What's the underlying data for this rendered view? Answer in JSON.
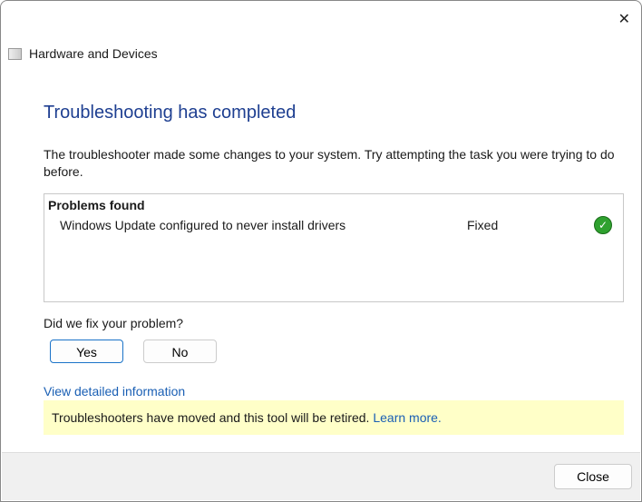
{
  "window": {
    "title": "Hardware and Devices",
    "close_glyph": "✕"
  },
  "heading": "Troubleshooting has completed",
  "description": "The troubleshooter made some changes to your system. Try attempting the task you were trying to do before.",
  "problems": {
    "header": "Problems found",
    "items": [
      {
        "title": "Windows Update configured to never install drivers",
        "status": "Fixed",
        "icon": "check-icon"
      }
    ]
  },
  "feedback": {
    "question": "Did we fix your problem?",
    "yes": "Yes",
    "no": "No"
  },
  "details_link": "View detailed information",
  "banner": {
    "text": "Troubleshooters have moved and this tool will be retired.",
    "link": "Learn more."
  },
  "footer": {
    "close": "Close"
  }
}
